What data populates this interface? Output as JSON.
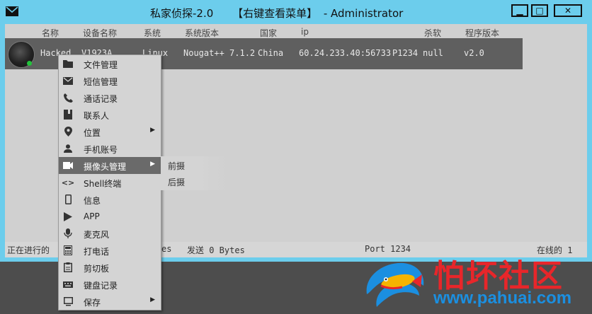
{
  "window": {
    "title_name": "私家侦探-2.0",
    "title_hint": "【右键查看菜单】",
    "title_user": "- Administrator",
    "minimize": "▁",
    "maximize": "□",
    "close": "✕"
  },
  "columns": [
    "名称",
    "设备名称",
    "系统",
    "系统版本",
    "国家",
    "ip",
    "杀软",
    "程序版本"
  ],
  "clients": [
    {
      "name": "Hacked",
      "device": "V1923A",
      "os": "Linux",
      "os_version": "Nougat++ 7.1.2",
      "country": "China",
      "ip": "60.24.233.40:56733",
      "port_tag": "P1234",
      "antivirus": "null",
      "app_version": "v2.0",
      "online": true
    }
  ],
  "context_menu": {
    "items": [
      {
        "label": "文件管理",
        "icon": "folder-icon",
        "submenu": false
      },
      {
        "label": "短信管理",
        "icon": "mail-icon",
        "submenu": false
      },
      {
        "label": "通话记录",
        "icon": "phone-icon",
        "submenu": false
      },
      {
        "label": "联系人",
        "icon": "contacts-book-icon",
        "submenu": false
      },
      {
        "label": "位置",
        "icon": "location-pin-icon",
        "submenu": true
      },
      {
        "label": "手机账号",
        "icon": "person-icon",
        "submenu": false
      },
      {
        "label": "摄像头管理",
        "icon": "camera-icon",
        "submenu": true,
        "active": true
      },
      {
        "label": "Shell终端",
        "icon": "code-icon",
        "submenu": false
      },
      {
        "label": "信息",
        "icon": "phone-device-icon",
        "submenu": false
      },
      {
        "label": "APP",
        "icon": "play-store-icon",
        "submenu": false
      },
      {
        "label": "麦克风",
        "icon": "microphone-icon",
        "submenu": false
      },
      {
        "label": "打电话",
        "icon": "dialpad-icon",
        "submenu": false
      },
      {
        "label": "剪切板",
        "icon": "clipboard-icon",
        "submenu": false
      },
      {
        "label": "键盘记录",
        "icon": "keyboard-icon",
        "submenu": false
      },
      {
        "label": "保存",
        "icon": "monitor-icon",
        "submenu": true
      }
    ],
    "camera_submenu": [
      "前摄",
      "后摄"
    ]
  },
  "status_bar": {
    "task_prefix": "正在进行的",
    "received_fragment": "es",
    "sent": "发送 0 Bytes",
    "port": "Port 1234",
    "online": "在线的 1"
  },
  "watermark": {
    "title": "怕坏社区",
    "url": "www.pahuai.com"
  },
  "colors": {
    "title_bar": "#6ccdec",
    "client_area": "#d0d0d0",
    "selected_row": "#5f5f5f",
    "menu_active": "#6a6a6a",
    "online_dot": "#22c33b",
    "watermark_red": "#e8262a",
    "watermark_blue": "#1b8fe0"
  }
}
